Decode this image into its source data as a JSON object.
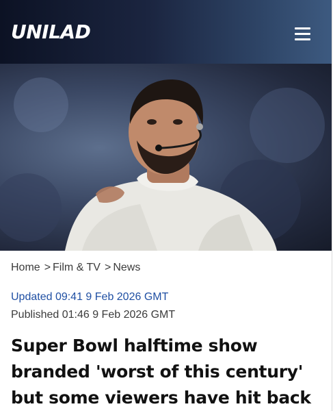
{
  "header": {
    "logo": "UNILAD",
    "menu_icon": "hamburger-menu-icon",
    "colors": {
      "gradient_start": "#0c1224",
      "gradient_end": "#3d5a80"
    }
  },
  "breadcrumb": {
    "items": [
      "Home",
      "Film & TV",
      "News"
    ],
    "separator": ">"
  },
  "article": {
    "updated": "Updated 09:41 9 Feb 2026 GMT",
    "published": "Published 01:46 9 Feb 2026 GMT",
    "headline": "Super Bowl halftime show branded 'worst of this century' but some viewers have hit back"
  },
  "colors": {
    "link_blue": "#1f4fa3",
    "text_gray": "#3b3b3b",
    "headline": "#111111"
  }
}
